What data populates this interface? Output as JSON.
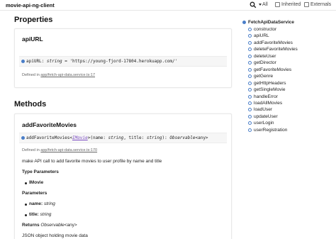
{
  "toolbar": {
    "title": "movie-api-ng-client",
    "options": {
      "all": "All",
      "inherited": "Inherited",
      "externals": "Externals"
    }
  },
  "properties": {
    "heading": "Properties",
    "item": {
      "name": "apiURL",
      "sig_name": "apiURL",
      "sig_sep": ": ",
      "sig_type": "string",
      "sig_rest": " = 'https://young-fjord-17804.herokuapp.com/'",
      "defined_prefix": "Defined in ",
      "defined_link": "app/fetch-api-data.service.ts:17"
    }
  },
  "methods": {
    "heading": "Methods",
    "item": {
      "name": "addFavoriteMovies",
      "sig_name": "addFavoriteMovies<",
      "sig_generic": "IMovie",
      "sig_params": ">(name: ",
      "sig_t1": "string",
      "sig_mid": ", title: ",
      "sig_t2": "string",
      "sig_ret_prefix": "): ",
      "sig_ret": "Observable",
      "sig_ret_generic": "<any>",
      "defined_prefix": "Defined in ",
      "defined_link": "app/fetch-api-data.service.ts:170",
      "description": "make API call to add favorite movies to user profile by name and title",
      "type_params_heading": "Type Parameters",
      "type_param": "IMovie",
      "params_heading": "Parameters",
      "param1_name": "name: ",
      "param1_type": "string",
      "param2_name": "title: ",
      "param2_type": "string",
      "returns_label": "Returns ",
      "returns_type": "Observable",
      "returns_generic": "<any>",
      "returns_desc": "JSON object holding movie data"
    }
  },
  "nav": {
    "title": "FetchApiDataService",
    "items": [
      "constructor",
      "apiURL",
      "addFavoriteMovies",
      "deleteFavoriteMovies",
      "deleteUser",
      "getDirector",
      "getFavoriteMovies",
      "getGenre",
      "getHttpHeaders",
      "getSingleMovie",
      "handleError",
      "loadAllMovies",
      "loadUser",
      "updateUser",
      "userLogin",
      "userRegistration"
    ]
  },
  "colors": {
    "accent": "#4a7ec8",
    "generic": "#7a4ac2"
  }
}
